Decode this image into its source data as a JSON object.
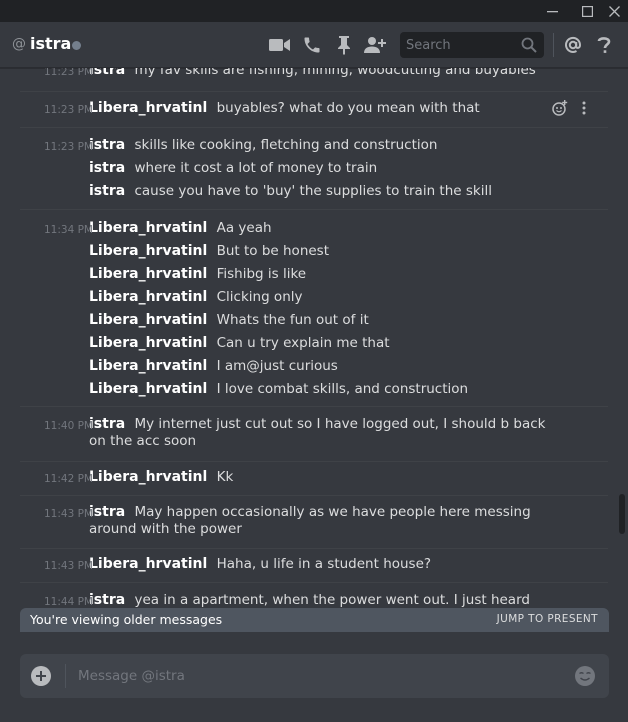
{
  "window": {
    "controls": [
      "minimize-icon",
      "maximize-icon",
      "close-icon"
    ]
  },
  "header": {
    "at_symbol": "@",
    "name": "istra",
    "status": "offline",
    "icons": [
      "video-call-icon",
      "voice-call-icon",
      "pin-icon",
      "add-friend-icon",
      "mention-icon",
      "help-icon"
    ],
    "search_placeholder": "Search"
  },
  "messages": [
    {
      "lines": [
        {
          "time": "11:23 PM",
          "author": "istra",
          "text": "my fav skills are fishing, mining, woodcutting and buyables"
        }
      ]
    },
    {
      "lines": [
        {
          "time": "11:23 PM",
          "author": "Libera_hrvatinl",
          "text": "buyables? what do you mean with that"
        }
      ],
      "hover_icons": [
        "add-reaction-icon",
        "more-options-icon"
      ]
    },
    {
      "lines": [
        {
          "time": "11:23 PM",
          "author": "istra",
          "text": "skills like cooking, fletching and construction"
        },
        {
          "time": "",
          "author": "istra",
          "text": "where it cost a lot of money to train"
        },
        {
          "time": "",
          "author": "istra",
          "text": "cause you have to 'buy' the supplies to train the skill"
        }
      ]
    },
    {
      "lines": [
        {
          "time": "11:34 PM",
          "author": "Libera_hrvatinl",
          "text": "Aa yeah"
        },
        {
          "time": "",
          "author": "Libera_hrvatinl",
          "text": "But to be honest"
        },
        {
          "time": "",
          "author": "Libera_hrvatinl",
          "text": "Fishibg is like"
        },
        {
          "time": "",
          "author": "Libera_hrvatinl",
          "text": "Clicking only"
        },
        {
          "time": "",
          "author": "Libera_hrvatinl",
          "text": "Whats the fun out of it"
        },
        {
          "time": "",
          "author": "Libera_hrvatinl",
          "text": "Can u try explain me that"
        },
        {
          "time": "",
          "author": "Libera_hrvatinl",
          "text": "I am@just curious"
        },
        {
          "time": "",
          "author": "Libera_hrvatinl",
          "text": "I love combat skills, and construction"
        }
      ]
    },
    {
      "lines": [
        {
          "time": "11:40 PM",
          "author": "istra",
          "text": "My internet just cut out so I have logged out, I should b back on the acc soon"
        }
      ]
    },
    {
      "lines": [
        {
          "time": "11:42 PM",
          "author": "Libera_hrvatinl",
          "text": "Kk"
        }
      ]
    },
    {
      "lines": [
        {
          "time": "11:43 PM",
          "author": "istra",
          "text": "May happen occasionally as we have people here messing around with the power"
        }
      ]
    },
    {
      "lines": [
        {
          "time": "11:43 PM",
          "author": "Libera_hrvatinl",
          "text": "Haha, u life in a student house?"
        }
      ]
    },
    {
      "lines": [
        {
          "time": "11:44 PM",
          "author": "istra",
          "text": "yea in a apartment, when the power went out. I just heard heaps of"
        }
      ]
    }
  ],
  "older_bar": {
    "text": "You're viewing older messages",
    "jump_label": "JUMP TO PRESENT"
  },
  "composer": {
    "placeholder": "Message @istra",
    "attach_icon": "add-attachment-icon",
    "emoji_icon": "emoji-icon"
  }
}
